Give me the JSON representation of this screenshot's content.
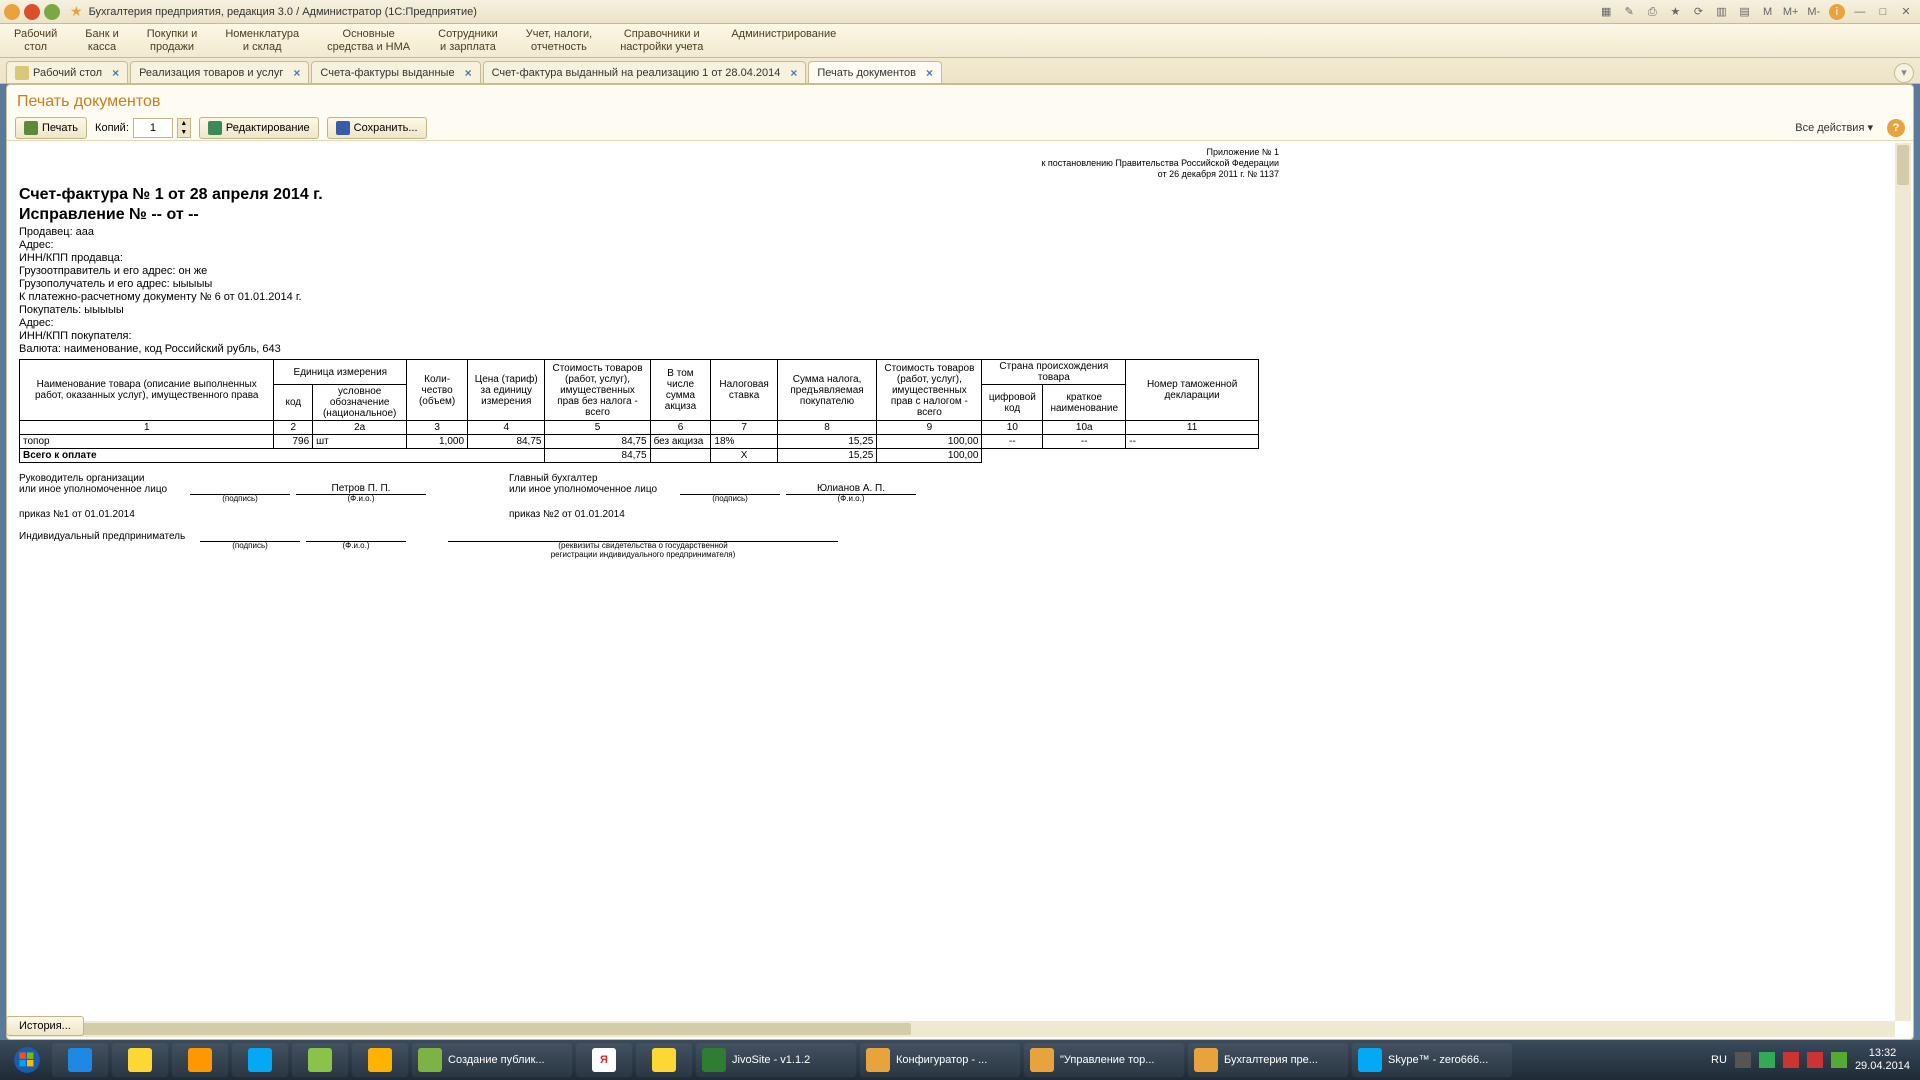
{
  "window": {
    "title": "Бухгалтерия предприятия, редакция 3.0 / Администратор  (1С:Предприятие)",
    "right_letters": [
      "M",
      "M+",
      "M-"
    ]
  },
  "menu": [
    "Рабочий\nстол",
    "Банк и\nкасса",
    "Покупки и\nпродажи",
    "Номенклатура\nи склад",
    "Основные\nсредства и НМА",
    "Сотрудники\nи зарплата",
    "Учет, налоги,\nотчетность",
    "Справочники и\nнастройки учета",
    "Администрирование"
  ],
  "tabs": [
    {
      "label": "Рабочий стол",
      "closable": true,
      "icon": true
    },
    {
      "label": "Реализация товаров и услуг",
      "closable": true
    },
    {
      "label": "Счета-фактуры выданные",
      "closable": true
    },
    {
      "label": "Счет-фактура выданный на реализацию 1 от 28.04.2014",
      "closable": true
    },
    {
      "label": "Печать документов",
      "closable": true,
      "active": true
    }
  ],
  "page": {
    "title": "Печать документов",
    "print_btn": "Печать",
    "copies_label": "Копий:",
    "copies_value": "1",
    "edit_btn": "Редактирование",
    "save_btn": "Сохранить...",
    "all_actions": "Все действия ▾"
  },
  "doc": {
    "appendix": [
      "Приложение № 1",
      "к постановлению Правительства Российской Федерации",
      "от 26 декабря 2011 г. № 1137"
    ],
    "h1": "Счет-фактура № 1 от 28 апреля 2014 г.",
    "h2": "Исправление № -- от --",
    "fields": [
      "Продавец: ааа",
      "Адрес:",
      "ИНН/КПП продавца:",
      "Грузоотправитель и его адрес: он же",
      "Грузополучатель и его адрес: ыыыыы",
      "К платежно-расчетному документу № 6 от 01.01.2014 г.",
      "Покупатель: ыыыыы",
      "Адрес:",
      "ИНН/КПП покупателя:",
      "Валюта: наименование, код Российский рубль, 643"
    ],
    "headers": {
      "name": "Наименование товара (описание выполненных работ, оказанных услуг), имущественного права",
      "unit": "Единица измерения",
      "unit_code": "код",
      "unit_name": "условное обозначение (национальное)",
      "qty": "Коли-\nчество (объем)",
      "price": "Цена (тариф) за единицу измерения",
      "cost_no_tax": "Стоимость товаров (работ, услуг), имущественных прав без налога - всего",
      "excise": "В том числе сумма акциза",
      "rate": "Налоговая ставка",
      "tax_sum": "Сумма налога, предъявляемая покупателю",
      "cost_with_tax": "Стоимость товаров (работ, услуг), имущественных прав с налогом - всего",
      "country": "Страна происхождения товара",
      "country_code": "цифровой код",
      "country_name": "краткое наименование",
      "decl": "Номер таможенной декларации"
    },
    "col_nums": [
      "1",
      "2",
      "2а",
      "3",
      "4",
      "5",
      "6",
      "7",
      "8",
      "9",
      "10",
      "10а",
      "11"
    ],
    "row": {
      "name": "топор",
      "code": "796",
      "unit": "шт",
      "qty": "1,000",
      "price": "84,75",
      "cost_no": "84,75",
      "excise": "без акциза",
      "rate": "18%",
      "tax": "15,25",
      "cost_with": "100,00",
      "ccode": "--",
      "cname": "--",
      "decl": "--"
    },
    "total_label": "Всего к оплате",
    "totals": {
      "cost_no": "84,75",
      "rate_x": "Х",
      "tax": "15,25",
      "cost_with": "100,00"
    },
    "sig": {
      "head": "Руководитель организации",
      "or": "или иное уполномоченное лицо",
      "head_name": "Петров П. П.",
      "acct": "Главный бухгалтер",
      "acct_name": "Юлианов А. П.",
      "podpis": "(подпись)",
      "fio": "(Ф.и.о.)",
      "order1": "приказ №1 от 01.01.2014",
      "order2": "приказ №2 от 01.01.2014",
      "ip": "Индивидуальный предприниматель",
      "ip_note": "(реквизиты свидетельства о государственной\nрегистрации индивидуального предпринимателя)"
    }
  },
  "history_btn": "История...",
  "taskbar": {
    "items": [
      {
        "label": "Создание публик...",
        "color": "#7cb342"
      },
      {
        "label": "",
        "color": "#d84315",
        "icon": "Я"
      },
      {
        "label": "",
        "color": "#fdd835"
      },
      {
        "label": "JivoSite - v1.1.2",
        "color": "#2e7d32"
      },
      {
        "label": "Конфигуратор - ...",
        "color": "#e8a33d"
      },
      {
        "label": "\"Управление тор...",
        "color": "#e8a33d"
      },
      {
        "label": "Бухгалтерия пре...",
        "color": "#e8a33d"
      },
      {
        "label": "Skype™ - zero666...",
        "color": "#03a9f4"
      }
    ],
    "lang": "RU",
    "time": "13:32",
    "date": "29.04.2014"
  }
}
